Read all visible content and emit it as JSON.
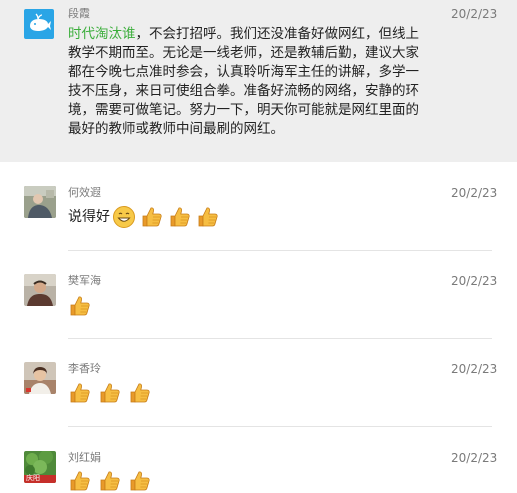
{
  "post": {
    "author": "段霞",
    "date": "20/2/23",
    "topic": "时代淘汰谁",
    "text": "，不会打招呼。我们还没准备好做网红，但线上教学不期而至。无论是一线老师，还是教辅后勤，建议大家都在今晚七点准时参会，认真聆听海军主任的讲解，多学一技不压身，来日可使组合拳。准备好流畅的网络，安静的环境，需要可做笔记。努力一下，明天你可能就是网红里面的最好的教师或教师中间最刷的网红。"
  },
  "comments": [
    {
      "author": "何效遐",
      "date": "20/2/23",
      "text": "说得好",
      "emoji": [
        "grin-emoji",
        "thumbs-up-emoji",
        "thumbs-up-emoji",
        "thumbs-up-emoji"
      ]
    },
    {
      "author": "樊军海",
      "date": "20/2/23",
      "text": "",
      "emoji": [
        "thumbs-up-emoji"
      ]
    },
    {
      "author": "李香玲",
      "date": "20/2/23",
      "text": "",
      "emoji": [
        "thumbs-up-emoji",
        "thumbs-up-emoji",
        "thumbs-up-emoji"
      ]
    },
    {
      "author": "刘红娟",
      "date": "20/2/23",
      "text": "",
      "emoji": [
        "thumbs-up-emoji",
        "thumbs-up-emoji",
        "thumbs-up-emoji"
      ],
      "avatar_caption": "庆阳"
    }
  ],
  "colors": {
    "topic": "#3cae3c",
    "meta": "#7a7a7a",
    "post_bg": "#eeeeee",
    "whale_avatar": "#2aa5e6",
    "thumb": "#f3b13a"
  }
}
